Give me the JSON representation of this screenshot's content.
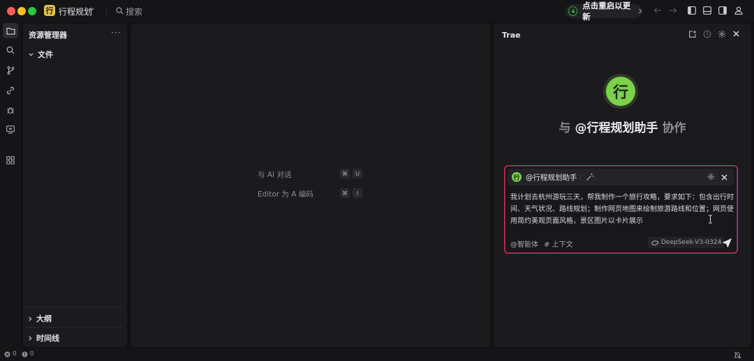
{
  "titlebar": {
    "project_initial": "行",
    "project_name": "行程规划",
    "search_placeholder": "搜索",
    "restart_label": "点击重启以更新"
  },
  "explorer": {
    "title": "资源管理器",
    "more": "···",
    "files_label": "文件",
    "outline_label": "大纲",
    "timeline_label": "时间线"
  },
  "editor": {
    "hint_chat_label": "与 AI 对话",
    "hint_chat_keys": [
      "⌘",
      "U"
    ],
    "hint_edit_label": "Editor 为 A  编码",
    "hint_edit_keys": [
      "⌘",
      "I"
    ]
  },
  "ai_panel": {
    "title": "Trae",
    "agent_initial": "行",
    "collab_prefix": "与",
    "agent_mention": "@行程规划助手",
    "collab_suffix": "协作",
    "chat": {
      "agent_name": "@行程规划助手",
      "message": "我计划去杭州游玩三天，帮我制作一个旅行攻略，要求如下：包含出行时间、天气状况、路线规划；制作网页地图来绘制旅游路线和位置；网页使用简约美观页面风格，景区图片以卡片展示",
      "agent_button": "@智能体",
      "context_button": "# 上下文",
      "model": "DeepSeek-V3-0324"
    }
  },
  "statusbar": {
    "errors": "0",
    "warnings": "0"
  },
  "colors": {
    "accent_green": "#7bd14a",
    "chat_border": "#d6314a",
    "background": "#111113",
    "panel": "#1b1b1e"
  }
}
